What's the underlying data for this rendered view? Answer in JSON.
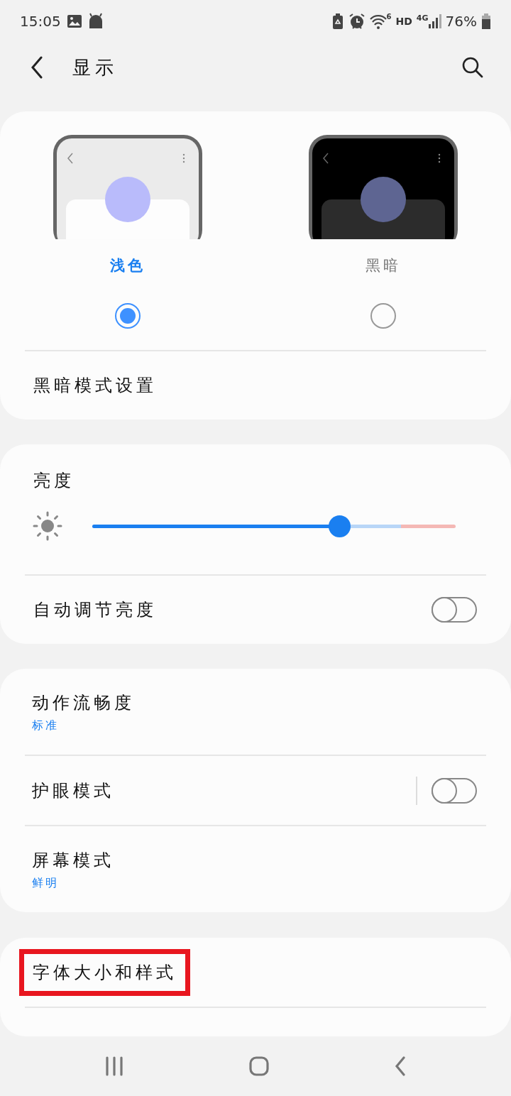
{
  "status_bar": {
    "time": "15:05",
    "wifi_badge": "6",
    "hd": "HD",
    "network": "4G",
    "battery": "76%"
  },
  "header": {
    "title": "显示"
  },
  "theme_options": [
    {
      "kind": "light",
      "label": "浅色",
      "selected": true
    },
    {
      "kind": "dark",
      "label": "黑暗",
      "selected": false
    }
  ],
  "dark_mode_settings": {
    "label": "黑暗模式设置"
  },
  "brightness": {
    "title": "亮度",
    "level": 0.68
  },
  "auto_brightness": {
    "label": "自动调节亮度",
    "on": false
  },
  "settings": [
    {
      "kind": "subtitle",
      "label": "动作流畅度",
      "subtitle": "标准"
    },
    {
      "kind": "toggle",
      "label": "护眼模式",
      "on": false
    },
    {
      "kind": "subtitle",
      "label": "屏幕模式",
      "subtitle": "鲜明"
    }
  ],
  "font_row": {
    "label": "字体大小和样式",
    "highlighted": true
  }
}
